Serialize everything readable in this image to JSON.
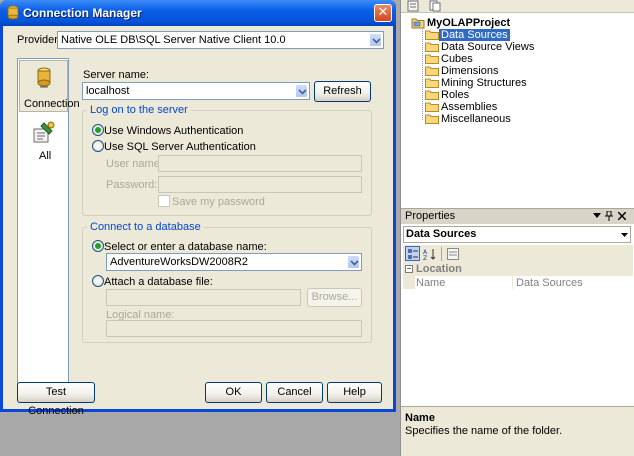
{
  "dialog": {
    "title": "Connection Manager",
    "provider_label": "Provider:",
    "provider_value": "Native OLE DB\\SQL Server Native Client 10.0",
    "nav": [
      {
        "label": "Connection",
        "icon": "connection-cylinder-icon"
      },
      {
        "label": "All",
        "icon": "all-properties-icon"
      }
    ],
    "server_name_label": "Server name:",
    "server_name_value": "localhost",
    "refresh_label": "Refresh",
    "logon_group": {
      "title": "Log on to the server",
      "windows_auth": "Use Windows Authentication",
      "sql_auth": "Use SQL Server Authentication",
      "user_name_label": "User name:",
      "password_label": "Password:",
      "save_password": "Save my password"
    },
    "db_group": {
      "title": "Connect to a database",
      "select_db": "Select or enter a database name:",
      "db_value": "AdventureWorksDW2008R2",
      "attach_db": "Attach a database file:",
      "browse_label": "Browse...",
      "logical_name_label": "Logical name:"
    },
    "buttons": {
      "test_connection": "Test Connection",
      "ok": "OK",
      "cancel": "Cancel",
      "help": "Help"
    }
  },
  "solution_explorer": {
    "project": "MyOLAPProject",
    "items": [
      "Data Sources",
      "Data Source Views",
      "Cubes",
      "Dimensions",
      "Mining Structures",
      "Roles",
      "Assemblies",
      "Miscellaneous"
    ]
  },
  "properties": {
    "title": "Properties",
    "object": "Data Sources",
    "category": "Location",
    "rows": [
      {
        "name": "Name",
        "value": "Data Sources"
      }
    ],
    "description_title": "Name",
    "description_text": "Specifies the name of the folder."
  },
  "colors": {
    "titlebar": "#0a5fe8",
    "dialog_bg": "#ece9d8",
    "group_title": "#0046d5",
    "selection": "#316ac5"
  }
}
